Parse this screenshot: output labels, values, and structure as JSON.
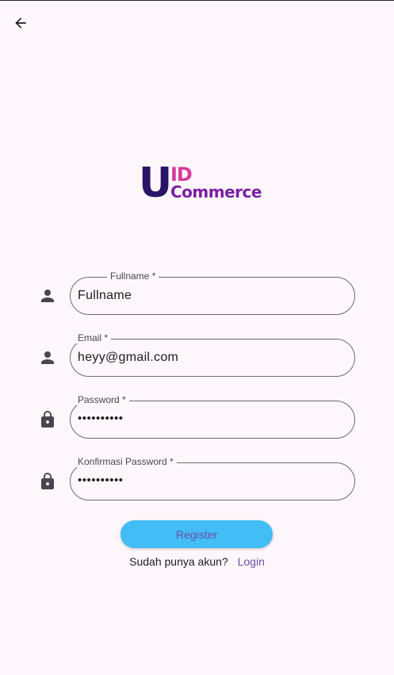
{
  "header": {
    "back_icon": "arrow-left-icon"
  },
  "logo": {
    "u": "U",
    "id": "ID",
    "commerce": "Commerce"
  },
  "form": {
    "fields": [
      {
        "label": "Fullname *",
        "value": "Fullname",
        "icon": "person-icon"
      },
      {
        "label": "Email *",
        "value": "heyy@gmail.com",
        "icon": "person-icon"
      },
      {
        "label": "Password *",
        "value": "••••••••••",
        "icon": "lock-icon"
      },
      {
        "label": "Konfirmasi Password *",
        "value": "••••••••••",
        "icon": "lock-icon"
      }
    ],
    "register_label": "Register",
    "login_prompt": "Sudah punya akun?",
    "login_link": "Login"
  },
  "colors": {
    "background": "#fdf7fb",
    "button": "#42bdf5",
    "button_text": "#6d4fa8",
    "link": "#6a4fa6",
    "logo_dark": "#2a1467",
    "logo_pink": "#d63a9c",
    "logo_purple": "#7b20a6"
  }
}
